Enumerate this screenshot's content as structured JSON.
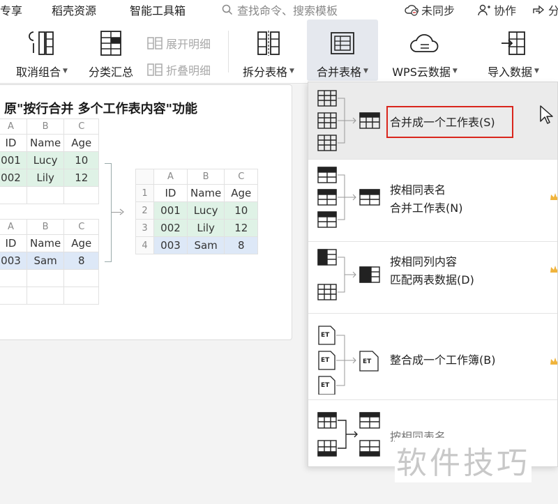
{
  "menu": {
    "items": [
      "专享",
      "稻壳资源",
      "智能工具箱"
    ],
    "search_placeholder": "查找命令、搜索模板",
    "sync_status": "未同步",
    "collab": "协作",
    "share": "分"
  },
  "ribbon": {
    "ungroup": "取消组合",
    "subtotal": "分类汇总",
    "expand_detail": "展开明细",
    "collapse_detail": "折叠明细",
    "split_table": "拆分表格",
    "merge_table": "合并表格",
    "wps_cloud": "WPS云数据",
    "import_data": "导入数据"
  },
  "preview": {
    "title": "原\"按行合并 多个工作表内容\"功能",
    "col_headers": [
      "A",
      "B",
      "C"
    ],
    "sheet1": {
      "rows": [
        {
          "id": "ID",
          "name": "Name",
          "age": "Age"
        },
        {
          "id": "001",
          "name": "Lucy",
          "age": "10"
        },
        {
          "id": "002",
          "name": "Lily",
          "age": "12"
        },
        {
          "id": "",
          "name": "",
          "age": ""
        }
      ]
    },
    "sheet2": {
      "rows": [
        {
          "id": "ID",
          "name": "Name",
          "age": "Age"
        },
        {
          "id": "003",
          "name": "Sam",
          "age": "8"
        },
        {
          "id": "",
          "name": "",
          "age": ""
        },
        {
          "id": "",
          "name": "",
          "age": ""
        }
      ]
    },
    "merged": {
      "row_numbers": [
        "1",
        "2",
        "3",
        "4"
      ],
      "rows": [
        {
          "id": "ID",
          "name": "Name",
          "age": "Age"
        },
        {
          "id": "001",
          "name": "Lucy",
          "age": "10"
        },
        {
          "id": "002",
          "name": "Lily",
          "age": "12"
        },
        {
          "id": "003",
          "name": "Sam",
          "age": "8"
        }
      ]
    }
  },
  "dropdown": {
    "items": [
      {
        "line1": "合并成一个工作表(S)",
        "line2": ""
      },
      {
        "line1": "按相同表名",
        "line2": "合并工作表(N)"
      },
      {
        "line1": "按相同列内容",
        "line2": "匹配两表数据(D)"
      },
      {
        "line1": "整合成一个工作簿(B)",
        "line2": ""
      },
      {
        "line1": "按相同表名",
        "line2": ""
      }
    ],
    "et_label": "ET"
  },
  "watermark": "软件技巧",
  "colors": {
    "highlight_box": "#d9251c",
    "green_fill": "#dff2e6",
    "blue_fill": "#dde8f7",
    "crown": "#f0b43c"
  }
}
